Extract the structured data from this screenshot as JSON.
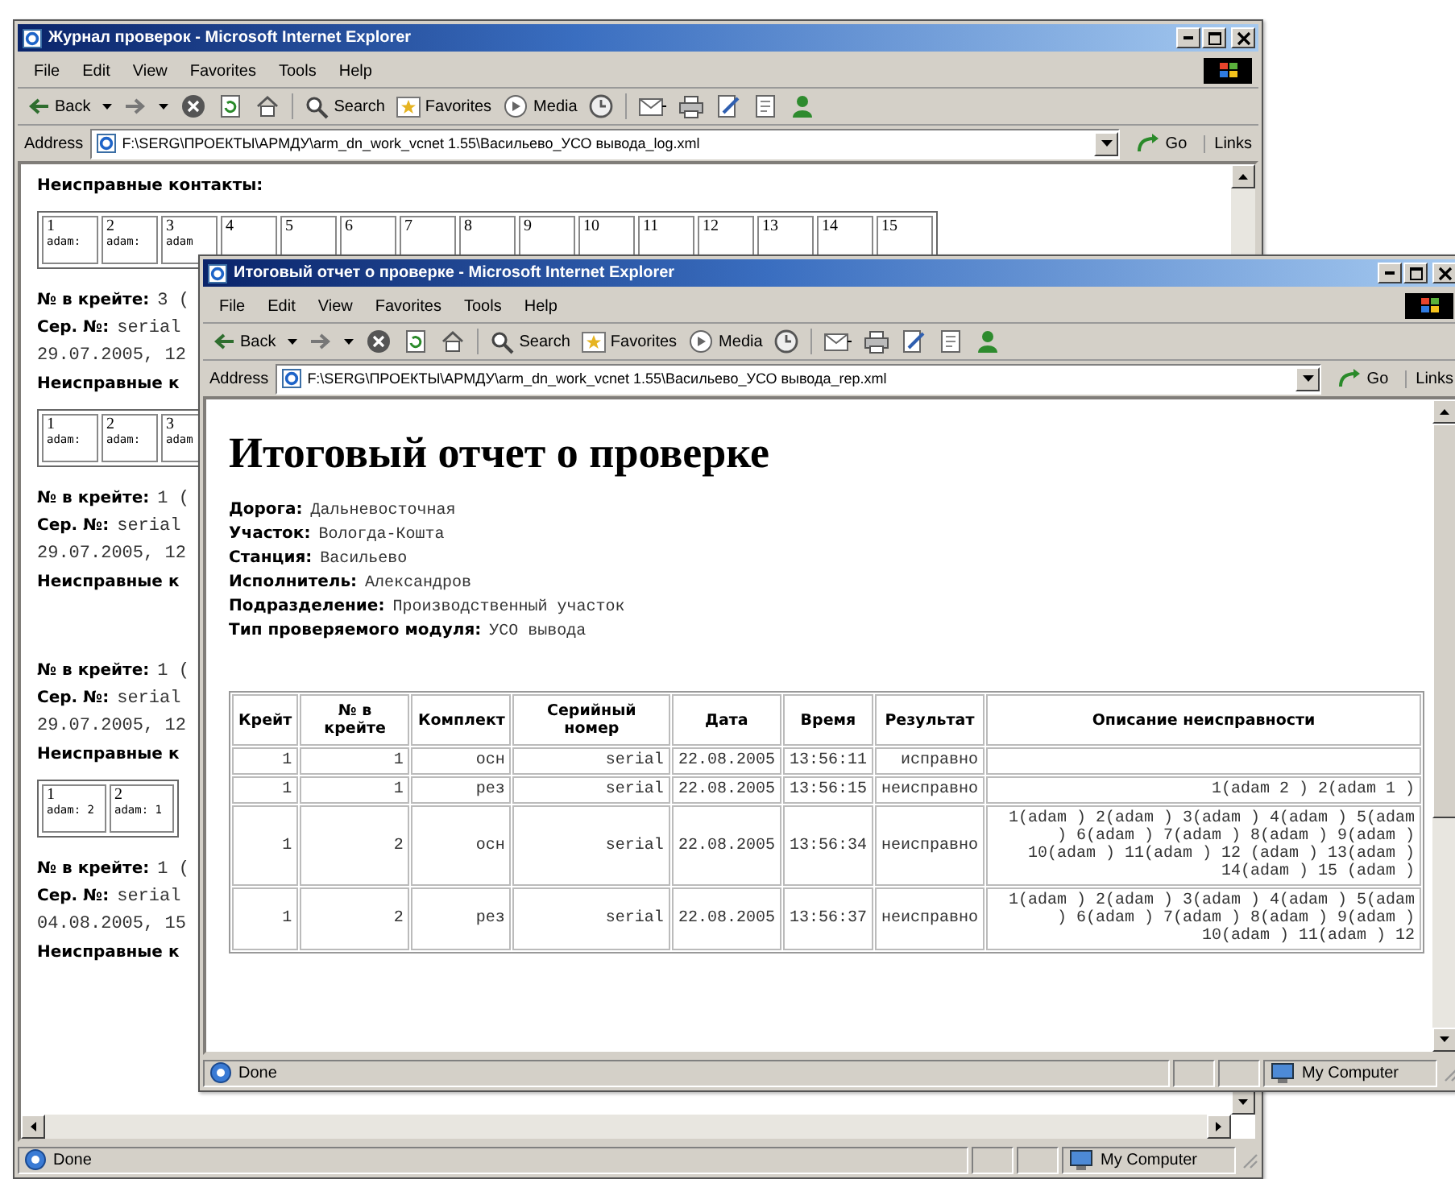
{
  "back_window": {
    "title": "Журнал проверок - Microsoft Internet Explorer",
    "menu": [
      "File",
      "Edit",
      "View",
      "Favorites",
      "Tools",
      "Help"
    ],
    "toolbar": [
      "Back",
      "Search",
      "Favorites",
      "Media"
    ],
    "address": {
      "label": "Address",
      "value": "F:\\SERG\\ПРОЕКТЫ\\АРМДУ\\arm_dn_work_vcnet 1.55\\Васильево_УСО вывода_log.xml"
    },
    "go": "Go",
    "links": "Links",
    "heading": "Неисправные контакты:",
    "contacts": [
      {
        "number": "1",
        "value": "adam:"
      },
      {
        "number": "2",
        "value": "adam:"
      },
      {
        "number": "3",
        "value": "adam"
      },
      {
        "number": "4"
      },
      {
        "number": "5"
      },
      {
        "number": "6"
      },
      {
        "number": "7"
      },
      {
        "number": "8"
      },
      {
        "number": "9"
      },
      {
        "number": "10"
      },
      {
        "number": "11"
      },
      {
        "number": "12"
      },
      {
        "number": "13"
      },
      {
        "number": "14"
      },
      {
        "number": "15"
      }
    ],
    "records": [
      {
        "crate_label": "№ в крейте:",
        "crate": "3 (",
        "serial_label": "Сер. №:",
        "serial": "serial",
        "datetime": "29.07.2005, 12",
        "faults": "Неисправные к",
        "contacts": [
          {
            "number": "1",
            "value": "adam:"
          },
          {
            "number": "2",
            "value": "adam:"
          },
          {
            "number": "3",
            "value": "adam"
          }
        ]
      },
      {
        "crate_label": "№ в крейте:",
        "crate": "1 (",
        "serial_label": "Сер. №:",
        "serial": "serial",
        "datetime": "29.07.2005, 12",
        "faults": "Неисправные к"
      },
      {
        "crate_label": "№ в крейте:",
        "crate": "1 (",
        "serial_label": "Сер. №:",
        "serial": "serial",
        "datetime": "29.07.2005, 12",
        "faults": "Неисправные к",
        "contacts": [
          {
            "number": "1",
            "value": "adam: 2"
          },
          {
            "number": "2",
            "value": "adam: 1"
          }
        ]
      },
      {
        "crate_label": "№ в крейте:",
        "crate": "1 (",
        "serial_label": "Сер. №:",
        "serial": "serial",
        "datetime": "04.08.2005, 15",
        "faults": "Неисправные к"
      }
    ],
    "status": "Done",
    "zone": "My Computer"
  },
  "front_window": {
    "title": "Итоговый отчет о проверке - Microsoft Internet Explorer",
    "menu": [
      "File",
      "Edit",
      "View",
      "Favorites",
      "Tools",
      "Help"
    ],
    "toolbar": [
      "Back",
      "Search",
      "Favorites",
      "Media"
    ],
    "address": {
      "label": "Address",
      "value": "F:\\SERG\\ПРОЕКТЫ\\АРМДУ\\arm_dn_work_vcnet 1.55\\Васильево_УСО вывода_rep.xml"
    },
    "go": "Go",
    "links": "Links",
    "report_title": "Итоговый отчет о проверке",
    "fields": [
      {
        "label": "Дорога:",
        "value": "Дальневосточная"
      },
      {
        "label": "Участок:",
        "value": "Вологда-Кошта"
      },
      {
        "label": "Станция:",
        "value": "Васильево"
      },
      {
        "label": "Исполнитель:",
        "value": "Александров"
      },
      {
        "label": "Подразделение:",
        "value": "Производственный участок"
      },
      {
        "label": "Тип проверяемого модуля:",
        "value": "УСО вывода"
      }
    ],
    "table": {
      "columns": [
        "Крейт",
        "№ в крейте",
        "Комплект",
        "Серийный номер",
        "Дата",
        "Время",
        "Результат",
        "Описание неисправности"
      ],
      "rows": [
        [
          "1",
          "1",
          "осн",
          "serial",
          "22.08.2005",
          "13:56:11",
          "исправно"
        ],
        [
          "1",
          "1",
          "рез",
          "serial",
          "22.08.2005",
          "13:56:15",
          "неисправно",
          "1(adam 2 ) 2(adam 1 )"
        ],
        [
          "1",
          "2",
          "осн",
          "serial",
          "22.08.2005",
          "13:56:34",
          "неисправно",
          "1(adam ) 2(adam ) 3(adam ) 4(adam ) 5(adam ) 6(adam ) 7(adam ) 8(adam ) 9(adam ) 10(adam ) 11(adam ) 12 (adam ) 13(adam ) 14(adam ) 15 (adam )"
        ],
        [
          "1",
          "2",
          "рез",
          "serial",
          "22.08.2005",
          "13:56:37",
          "неисправно",
          "1(adam ) 2(adam ) 3(adam ) 4(adam ) 5(adam ) 6(adam ) 7(adam ) 8(adam ) 9(adam ) 10(adam ) 11(adam ) 12"
        ]
      ]
    },
    "status": "Done",
    "zone": "My Computer"
  }
}
